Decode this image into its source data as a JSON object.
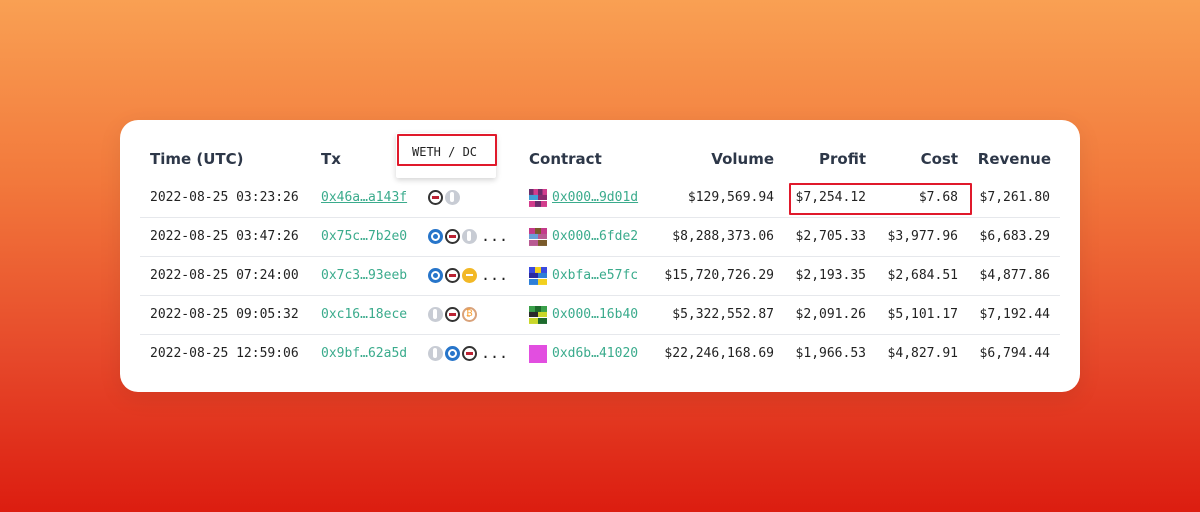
{
  "table": {
    "headers": {
      "time": "Time (UTC)",
      "tx": "Tx",
      "contract": "Contract",
      "volume": "Volume",
      "profit": "Profit",
      "cost": "Cost",
      "revenue": "Revenue"
    },
    "rows": [
      {
        "time": "2022-08-25 03:23:26",
        "tx": "0x46a…a143f",
        "tokens": [
          "weth",
          "eth"
        ],
        "more": "",
        "contract": "0x000…9d01d",
        "volume": "$129,569.94",
        "profit": "$7,254.12",
        "cost": "$7.68",
        "revenue": "$7,261.80"
      },
      {
        "time": "2022-08-25 03:47:26",
        "tx": "0x75c…7b2e0",
        "tokens": [
          "usdc",
          "weth",
          "eth"
        ],
        "more": "...",
        "contract": "0x000…6fde2",
        "volume": "$8,288,373.06",
        "profit": "$2,705.33",
        "cost": "$3,977.96",
        "revenue": "$6,683.29"
      },
      {
        "time": "2022-08-25 07:24:00",
        "tx": "0x7c3…93eeb",
        "tokens": [
          "usdc",
          "weth",
          "gold"
        ],
        "more": "...",
        "contract": "0xbfa…e57fc",
        "volume": "$15,720,726.29",
        "profit": "$2,193.35",
        "cost": "$2,684.51",
        "revenue": "$4,877.86"
      },
      {
        "time": "2022-08-25 09:05:32",
        "tx": "0xc16…18ece",
        "tokens": [
          "eth",
          "weth",
          "btc"
        ],
        "more": "",
        "contract": "0x000…16b40",
        "volume": "$5,322,552.87",
        "profit": "$2,091.26",
        "cost": "$5,101.17",
        "revenue": "$7,192.44"
      },
      {
        "time": "2022-08-25 12:59:06",
        "tx": "0x9bf…62a5d",
        "tokens": [
          "eth",
          "usdc",
          "weth"
        ],
        "more": "...",
        "contract": "0xd6b…41020",
        "volume": "$22,246,168.69",
        "profit": "$1,966.53",
        "cost": "$4,827.91",
        "revenue": "$6,794.44"
      }
    ]
  },
  "tooltip": {
    "text": "WETH / DC"
  },
  "colors": {
    "link": "#3aab8c",
    "highlight": "#e0192b"
  }
}
